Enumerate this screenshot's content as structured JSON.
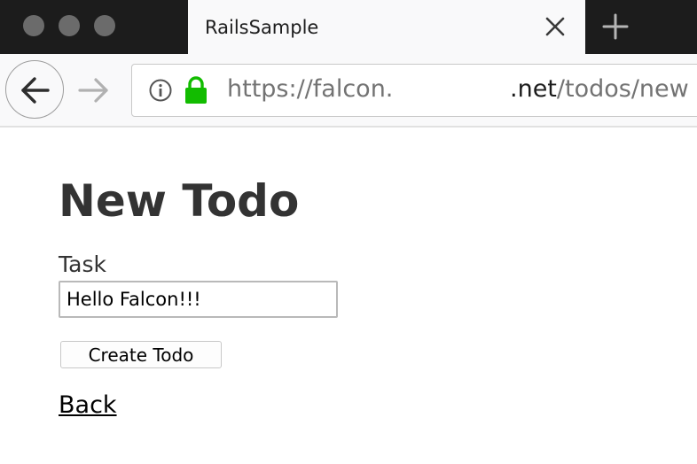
{
  "browser": {
    "tab_title": "RailsSample",
    "new_tab_symbol": "+",
    "address": {
      "prefix": "https://falcon.",
      "domain_end": ".net",
      "path": "/todos/new"
    },
    "icons": {
      "back": "back-arrow-icon",
      "forward": "forward-arrow-icon",
      "info": "info-icon",
      "lock": "lock-icon",
      "close": "close-icon",
      "new_tab": "plus-icon"
    },
    "colors": {
      "tabstrip": "#1c1c1c",
      "lock": "#12bc00",
      "traffic_lights": "#6b6b6b"
    }
  },
  "page": {
    "title": "New Todo",
    "task_label": "Task",
    "task_value": "Hello Falcon!!!",
    "submit_label": "Create Todo",
    "back_link": "Back"
  }
}
